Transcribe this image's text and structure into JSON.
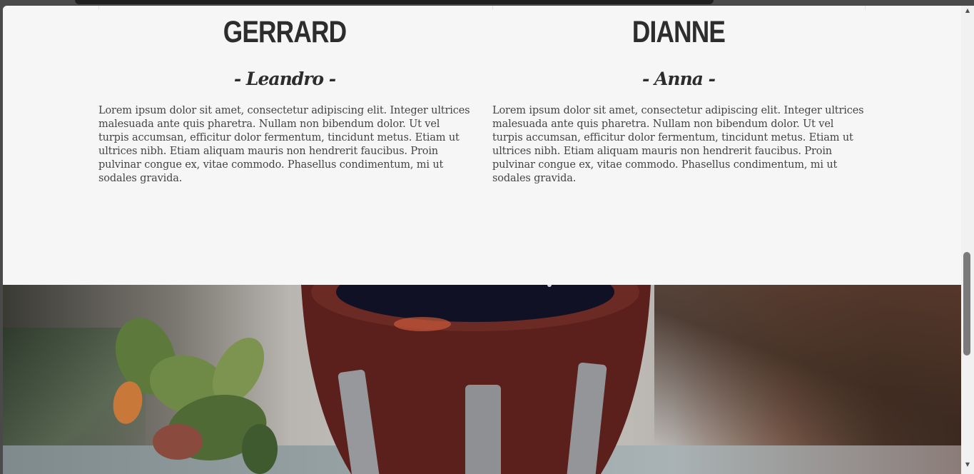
{
  "team": [
    {
      "name": "GERRARD",
      "nickname": "- Leandro -",
      "bio": "Lorem ipsum dolor sit amet, consectetur adipiscing elit. Integer ultrices malesuada ante quis pharetra. Nullam non bibendum dolor. Ut vel turpis accumsan, efficitur dolor fermentum, tincidunt metus. Etiam ut ultrices nibh. Etiam aliquam mauris non hendrerit faucibus. Proin pulvinar congue ex, vitae commodo. Phasellus condimentum, mi ut sodales gravida."
    },
    {
      "name": "DIANNE",
      "nickname": "- Anna -",
      "bio": "Lorem ipsum dolor sit amet, consectetur adipiscing elit. Integer ultrices malesuada ante quis pharetra. Nullam non bibendum dolor. Ut vel turpis accumsan, efficitur dolor fermentum, tincidunt metus. Etiam ut ultrices nibh. Etiam aliquam mauris non hendrerit faucibus. Proin pulvinar congue ex, vitae commodo. Phasellus condimentum, mi ut sodales gravida."
    }
  ],
  "scrollbar": {
    "up_icon": "chevron-up-icon",
    "down_icon": "chevron-down-icon",
    "up_glyph": "▲",
    "down_glyph": "▼"
  },
  "colors": {
    "page_background": "#f6f6f6",
    "heading_text": "#2d2d2d",
    "body_text": "#444444"
  }
}
